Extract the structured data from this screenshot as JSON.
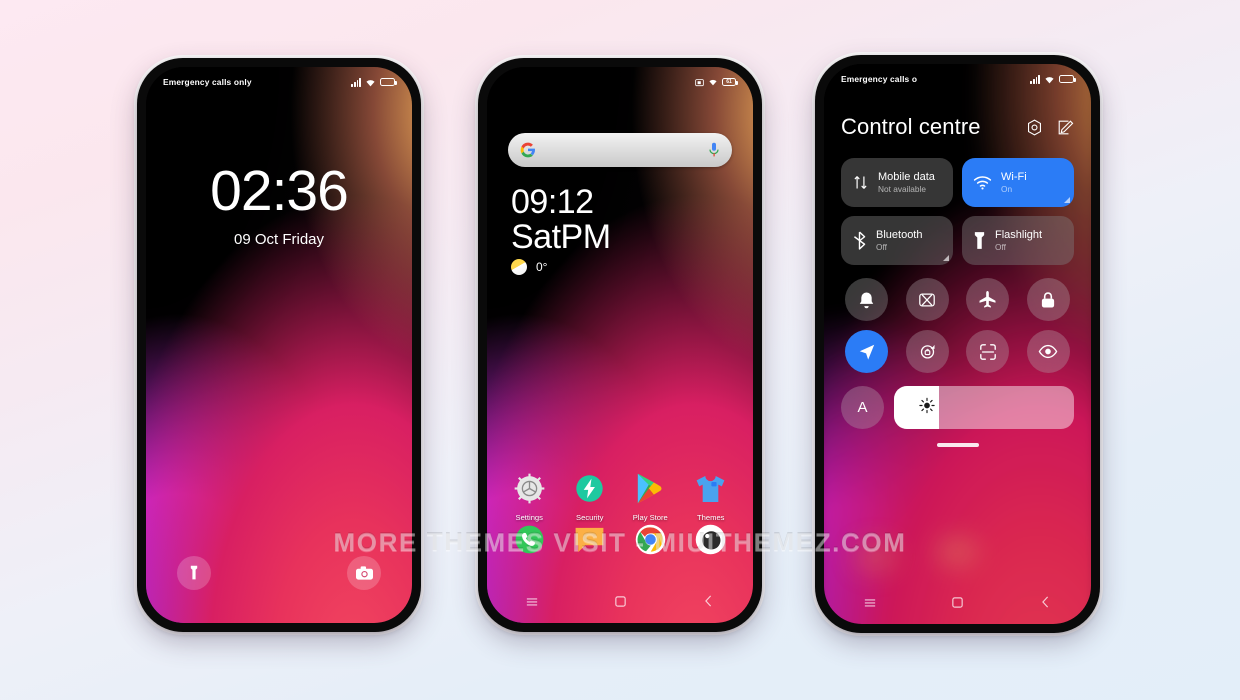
{
  "watermark": {
    "text": "MORE THEMES VISIT - MIUITHEMEZ.COM"
  },
  "phone1": {
    "status": {
      "carrier": "Emergency calls only",
      "signal_icon": "signal-bars-icon",
      "wifi_icon": "wifi-icon",
      "battery_icon": "battery-icon"
    },
    "lockscreen": {
      "time": "02:36",
      "date": "09 Oct Friday",
      "flashlight_icon": "flashlight-icon",
      "camera_icon": "camera-icon"
    }
  },
  "phone2": {
    "status": {
      "mute_icon": "screenshot-icon",
      "wifi_icon": "wifi-icon",
      "battery_level": "61"
    },
    "search": {
      "google_icon": "google-g-icon",
      "mic_icon": "microphone-icon"
    },
    "clock": {
      "time": "09:12",
      "day": "SatPM",
      "temperature": "0°",
      "weather_icon": "partly-sunny-icon"
    },
    "apps": [
      {
        "label": "Settings",
        "icon": "settings-gear-icon"
      },
      {
        "label": "Security",
        "icon": "security-bolt-icon"
      },
      {
        "label": "Play Store",
        "icon": "play-store-icon"
      },
      {
        "label": "Themes",
        "icon": "themes-shirt-icon"
      }
    ],
    "dock": [
      {
        "label": "Phone",
        "icon": "phone-icon"
      },
      {
        "label": "Messages",
        "icon": "messages-icon"
      },
      {
        "label": "Chrome",
        "icon": "chrome-icon"
      },
      {
        "label": "Camera",
        "icon": "camera-lens-icon"
      }
    ],
    "nav": [
      {
        "label": "Recents",
        "icon": "menu-icon"
      },
      {
        "label": "Home",
        "icon": "home-square-icon"
      },
      {
        "label": "Back",
        "icon": "back-chevron-icon"
      }
    ]
  },
  "phone3": {
    "status": {
      "carrier": "Emergency calls o",
      "signal_icon": "signal-bars-icon",
      "wifi_icon": "wifi-icon",
      "battery_icon": "battery-icon"
    },
    "header": {
      "title": "Control centre",
      "settings_icon": "settings-hex-icon",
      "edit_icon": "edit-pencil-icon"
    },
    "tiles": [
      {
        "name": "Mobile data",
        "sub": "Not available",
        "icon": "mobile-data-icon",
        "active": false
      },
      {
        "name": "Wi-Fi",
        "sub": "On",
        "icon": "wifi-icon",
        "active": true
      },
      {
        "name": "Bluetooth",
        "sub": "Off",
        "icon": "bluetooth-icon",
        "active": false
      },
      {
        "name": "Flashlight",
        "sub": "Off",
        "icon": "flashlight-icon",
        "active": false
      }
    ],
    "circles": [
      {
        "label": "Silent",
        "icon": "bell-icon",
        "active": false
      },
      {
        "label": "Screenshot",
        "icon": "screenshot-icon",
        "active": false
      },
      {
        "label": "Aeroplane",
        "icon": "airplane-icon",
        "active": false
      },
      {
        "label": "Lock",
        "icon": "lock-icon",
        "active": false
      },
      {
        "label": "Location",
        "icon": "location-icon",
        "active": true
      },
      {
        "label": "Auto-rotate",
        "icon": "auto-rotate-icon",
        "active": false
      },
      {
        "label": "Scanner",
        "icon": "scan-icon",
        "active": false
      },
      {
        "label": "Reading",
        "icon": "eye-icon",
        "active": false
      }
    ],
    "brightness": {
      "auto_label": "A",
      "level": 25,
      "icon": "brightness-icon"
    },
    "nav": [
      {
        "label": "Recents",
        "icon": "menu-icon"
      },
      {
        "label": "Home",
        "icon": "home-square-icon"
      },
      {
        "label": "Back",
        "icon": "back-chevron-icon"
      }
    ]
  },
  "colors": {
    "accent": "#2b7cf6",
    "wall_pink": "#e8325c",
    "wall_purple": "#a528ef",
    "wall_orange": "#f7b25c"
  }
}
